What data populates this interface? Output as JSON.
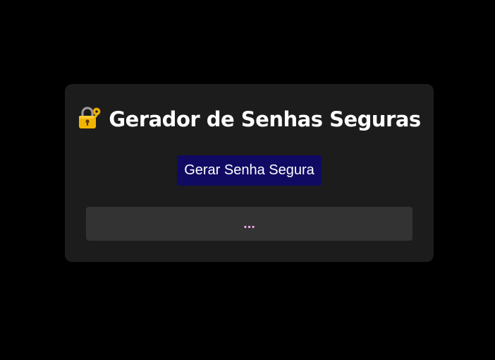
{
  "header": {
    "title": "Gerador de Senhas Seguras",
    "icon": "lock-with-key-icon"
  },
  "actions": {
    "generate_label": "Gerar Senha Segura"
  },
  "output": {
    "password": "..."
  },
  "colors": {
    "background": "#000000",
    "card": "#1c1c1c",
    "button": "#100a63",
    "output_box": "#333333",
    "output_text": "#f0a8f0"
  }
}
